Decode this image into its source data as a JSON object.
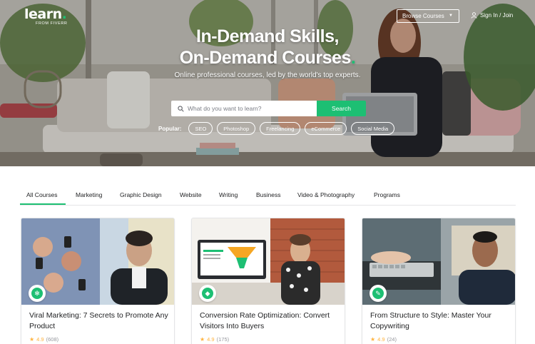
{
  "header": {
    "logo_text": "learn",
    "logo_sub": "FROM FIVERR",
    "browse_label": "Browse Courses",
    "signin_label": "Sign In / Join"
  },
  "hero": {
    "headline_line1": "In-Demand Skills,",
    "headline_line2": "On-Demand Courses",
    "subheading": "Online professional courses, led by the world's top experts.",
    "search_placeholder": "What do you want to learn?",
    "search_button": "Search",
    "popular_label": "Popular:",
    "popular_tags": [
      "SEO",
      "Photoshop",
      "Freelancing",
      "eCommerce",
      "Social Media"
    ]
  },
  "tabs": [
    "All Courses",
    "Marketing",
    "Graphic Design",
    "Website",
    "Writing",
    "Business",
    "Video & Photography",
    "Programs"
  ],
  "active_tab": "All Courses",
  "courses": [
    {
      "title": "Viral Marketing: 7 Secrets to Promote Any Product",
      "rating": "4.9",
      "count": "(608)",
      "badge_icon": "snowflake-icon",
      "badge_color": "#1dbf73"
    },
    {
      "title": "Conversion Rate Optimization: Convert Visitors Into Buyers",
      "rating": "4.9",
      "count": "(175)",
      "badge_icon": "tag-icon",
      "badge_color": "#1dbf73"
    },
    {
      "title": "From Structure to Style: Master Your Copywriting",
      "rating": "4.9",
      "count": "(24)",
      "badge_icon": "pen-icon",
      "badge_color": "#1dbf73"
    }
  ],
  "colors": {
    "accent": "#1dbf73",
    "star": "#ffb33e",
    "text": "#222325"
  }
}
